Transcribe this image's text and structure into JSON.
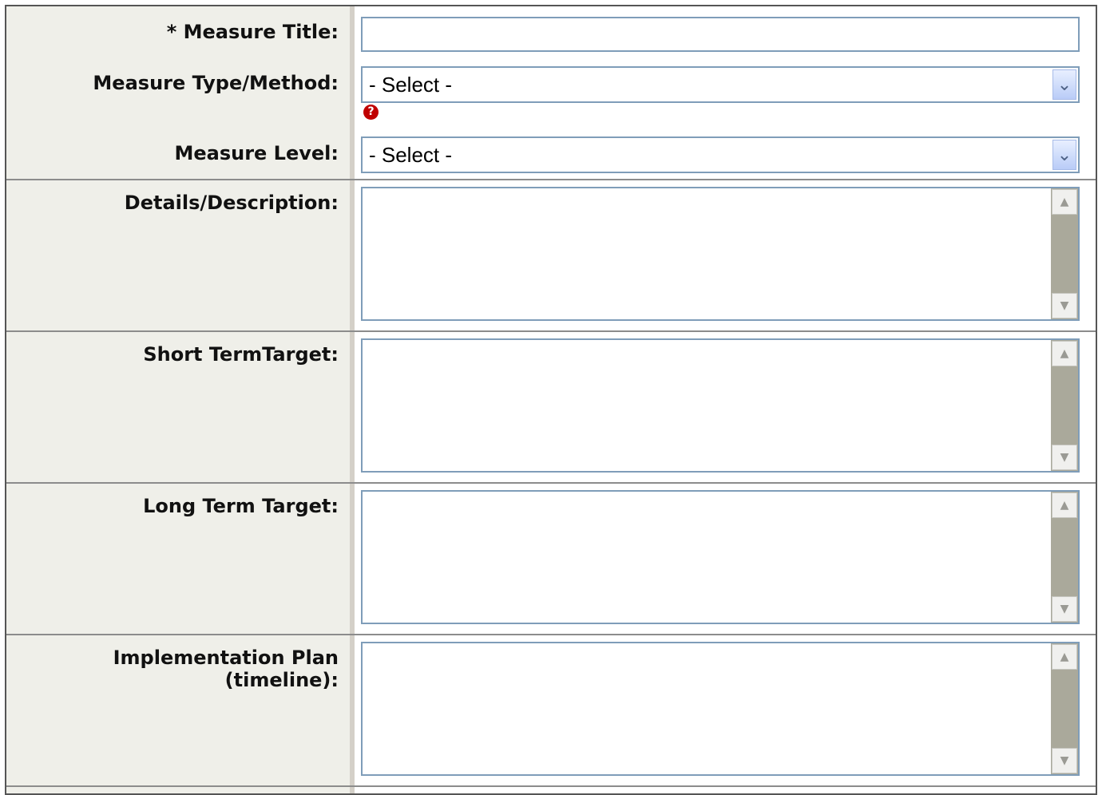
{
  "fields": {
    "measure_title": {
      "label": "* Measure Title:",
      "value": ""
    },
    "measure_type": {
      "label": "Measure Type/Method:",
      "selected": "- Select -",
      "help_icon": "help-question-icon"
    },
    "measure_level": {
      "label": "Measure Level:",
      "selected": "- Select -"
    },
    "details": {
      "label": "Details/Description:",
      "value": ""
    },
    "short_term_target": {
      "label": "Short TermTarget:",
      "value": ""
    },
    "long_term_target": {
      "label": "Long Term Target:",
      "value": ""
    },
    "implementation_plan": {
      "label_line1": "Implementation Plan",
      "label_line2": "(timeline):",
      "value": ""
    }
  },
  "icons": {
    "dropdown": "chevron-down-icon",
    "scroll_up": "scroll-up-arrow-icon",
    "scroll_down": "scroll-down-arrow-icon",
    "help": "question-mark-icon"
  },
  "colors": {
    "label_background": "#efefe9",
    "input_border": "#7f9db9",
    "scrollbar_track": "#aaa99b",
    "help_icon": "#c00000"
  }
}
